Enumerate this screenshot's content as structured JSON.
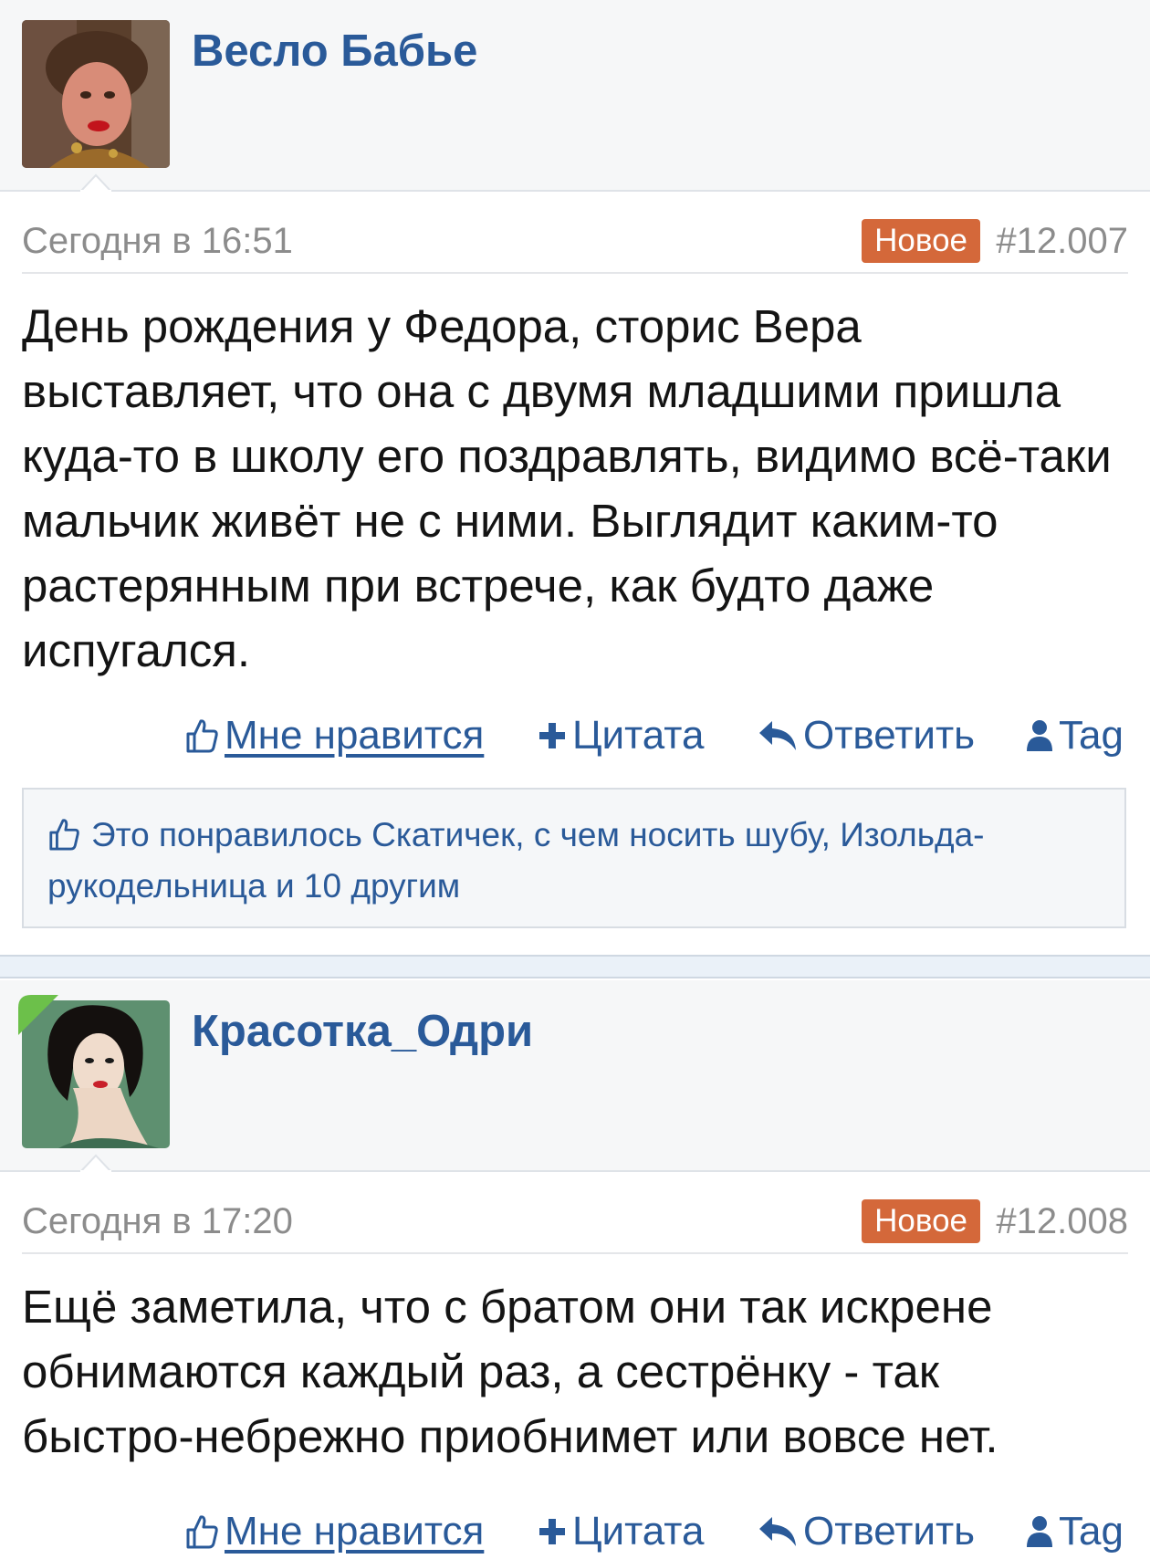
{
  "colors": {
    "link": "#2a5a99",
    "badge_bg": "#d4683a",
    "muted_text": "#8c8c8c",
    "header_bg": "#f6f7f8",
    "separator_bg": "#eaf1f8"
  },
  "posts": [
    {
      "username": "Весло Бабье",
      "date": "Сегодня в 16:51",
      "badge": "Новое",
      "number": "#12.007",
      "text": "День рождения у Федора, сторис Вера выставляет, что она с двумя младшими пришла куда-то в школу его поздравлять, видимо всё-таки мальчик живёт не с ними. Выглядит каким-то растерянным при встрече, как будто даже испугался.",
      "actions": {
        "like": "Мне нравится",
        "quote": "Цитата",
        "reply": "Ответить",
        "tag": "Tag"
      },
      "likes_summary": "Это понравилось Скатичек, с чем носить шубу, Изольда-рукодельница и 10 другим",
      "icons": [
        "thumbs-up-icon",
        "plus-icon",
        "reply-arrow-icon",
        "user-icon"
      ]
    },
    {
      "username": "Красотка_Одри",
      "date": "Сегодня в 17:20",
      "badge": "Новое",
      "number": "#12.008",
      "text": "Ещё заметила, что с братом они так искрене обнимаются каждый раз, а сестрёнку - так быстро-небрежно приобнимет или вовсе нет.",
      "actions": {
        "like": "Мне нравится",
        "quote": "Цитата",
        "reply": "Ответить",
        "tag": "Tag"
      },
      "icons": [
        "thumbs-up-icon",
        "plus-icon",
        "reply-arrow-icon",
        "user-icon"
      ]
    }
  ]
}
